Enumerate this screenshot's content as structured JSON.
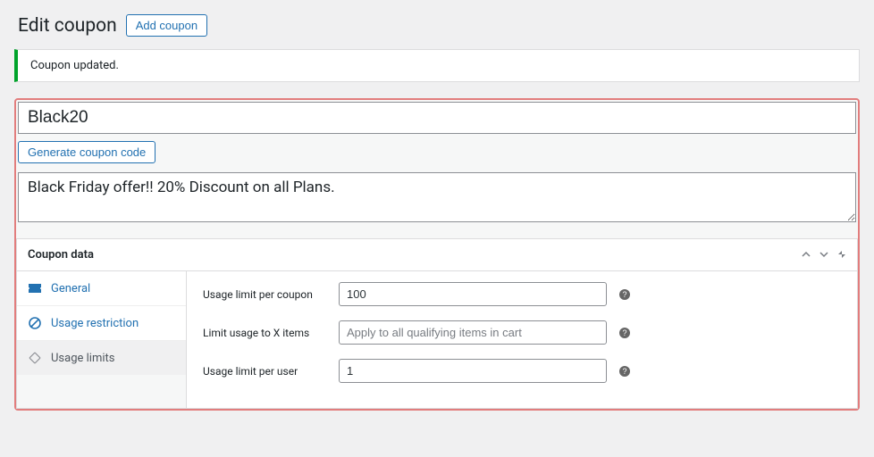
{
  "header": {
    "title": "Edit coupon",
    "add_button": "Add coupon"
  },
  "notice": {
    "message": "Coupon updated."
  },
  "coupon": {
    "code": "Black20",
    "generate_button": "Generate coupon code",
    "description": "Black Friday offer!! 20% Discount on all Plans."
  },
  "panel": {
    "title": "Coupon data",
    "tabs": {
      "general": "General",
      "usage_restriction": "Usage restriction",
      "usage_limits": "Usage limits"
    },
    "fields": {
      "limit_per_coupon": {
        "label": "Usage limit per coupon",
        "value": "100"
      },
      "limit_items": {
        "label": "Limit usage to X items",
        "placeholder": "Apply to all qualifying items in cart"
      },
      "limit_per_user": {
        "label": "Usage limit per user",
        "value": "1"
      }
    }
  }
}
